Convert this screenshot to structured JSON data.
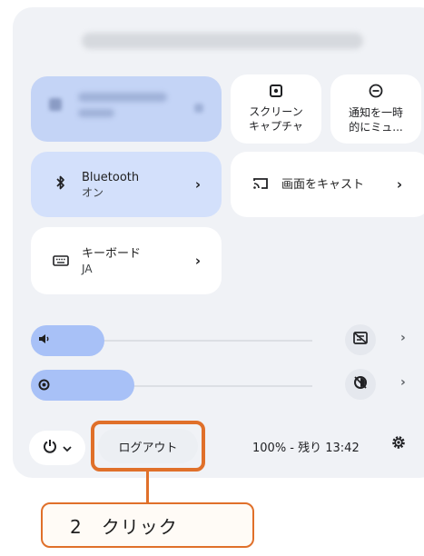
{
  "quick_settings": {
    "screen_capture": {
      "icon": "screen-capture-icon",
      "label_1": "スクリーン",
      "label_2": "キャプチャ"
    },
    "mute_notifications": {
      "icon": "do-not-disturb-icon",
      "label_1": "通知を一時",
      "label_2": "的にミュ..."
    },
    "bluetooth": {
      "icon": "bluetooth-icon",
      "title": "Bluetooth",
      "status": "オン"
    },
    "cast": {
      "icon": "cast-icon",
      "title": "画面をキャスト"
    },
    "keyboard": {
      "icon": "keyboard-icon",
      "title": "キーボード",
      "sub": "JA"
    },
    "volume": {
      "icon": "volume-icon",
      "level": 0.17
    },
    "brightness": {
      "icon": "brightness-icon",
      "level": 0.29
    },
    "logout_label": "ログアウト",
    "battery_text": "100% - 残り 13:42",
    "accent_color": "#a8c1f7"
  },
  "annotation": {
    "step_text": "2　クリック",
    "highlight_color": "#e0702a"
  }
}
